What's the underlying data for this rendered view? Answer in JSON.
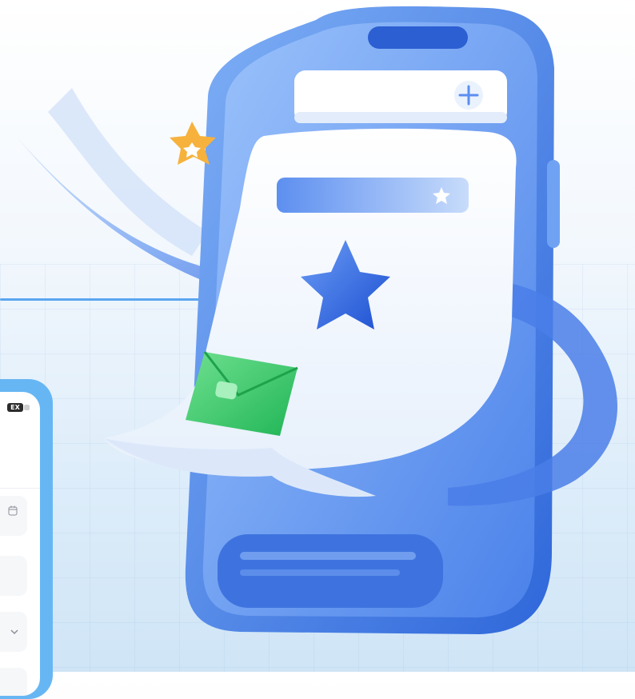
{
  "mini_form": {
    "battery_label": "EX"
  },
  "icons": {
    "add": "plus-icon",
    "star": "star-icon",
    "envelope": "envelope-icon",
    "calendar": "calendar-icon",
    "dropdown": "chevron-down-icon"
  },
  "colors": {
    "accent": "#5aa6f0",
    "phone_blue": "#3f7ee8",
    "star_orange": "#f6b23d",
    "envelope_green": "#3fcb6b",
    "mockup_frame": "#67b6f4"
  }
}
